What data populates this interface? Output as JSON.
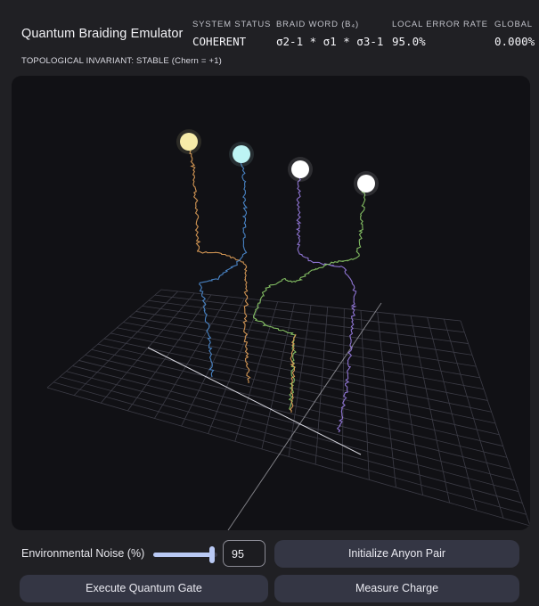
{
  "app": {
    "title": "Quantum Braiding Emulator",
    "invariant": "TOPOLOGICAL INVARIANT: STABLE (Chern = +1)"
  },
  "status": [
    {
      "label": "SYSTEM STATUS",
      "value": "COHERENT"
    },
    {
      "label": "BRAID WORD (B₄)",
      "value": "σ2-1 * σ1 * σ3-1"
    },
    {
      "label": "LOCAL ERROR RATE",
      "value": "95.0%"
    },
    {
      "label": "GLOBAL",
      "value": "0.000%"
    }
  ],
  "visualization": {
    "anyon_colors": [
      "#f6eba8",
      "#bdf4f4",
      "#ffffff",
      "#ffffff"
    ],
    "strand_colors": [
      "#e6a35a",
      "#4f8fd6",
      "#9b7ee6",
      "#8fcf6a"
    ],
    "grid_color": "#3c3c46",
    "axis_color": "#d8d8e0"
  },
  "controls": {
    "noise_label": "Environmental Noise (%)",
    "noise_value": "95",
    "noise_fraction": 0.95,
    "accent_color": "#b9c9f4",
    "init_button": "Initialize Anyon Pair",
    "execute_button": "Execute Quantum Gate",
    "measure_button": "Measure Charge"
  }
}
